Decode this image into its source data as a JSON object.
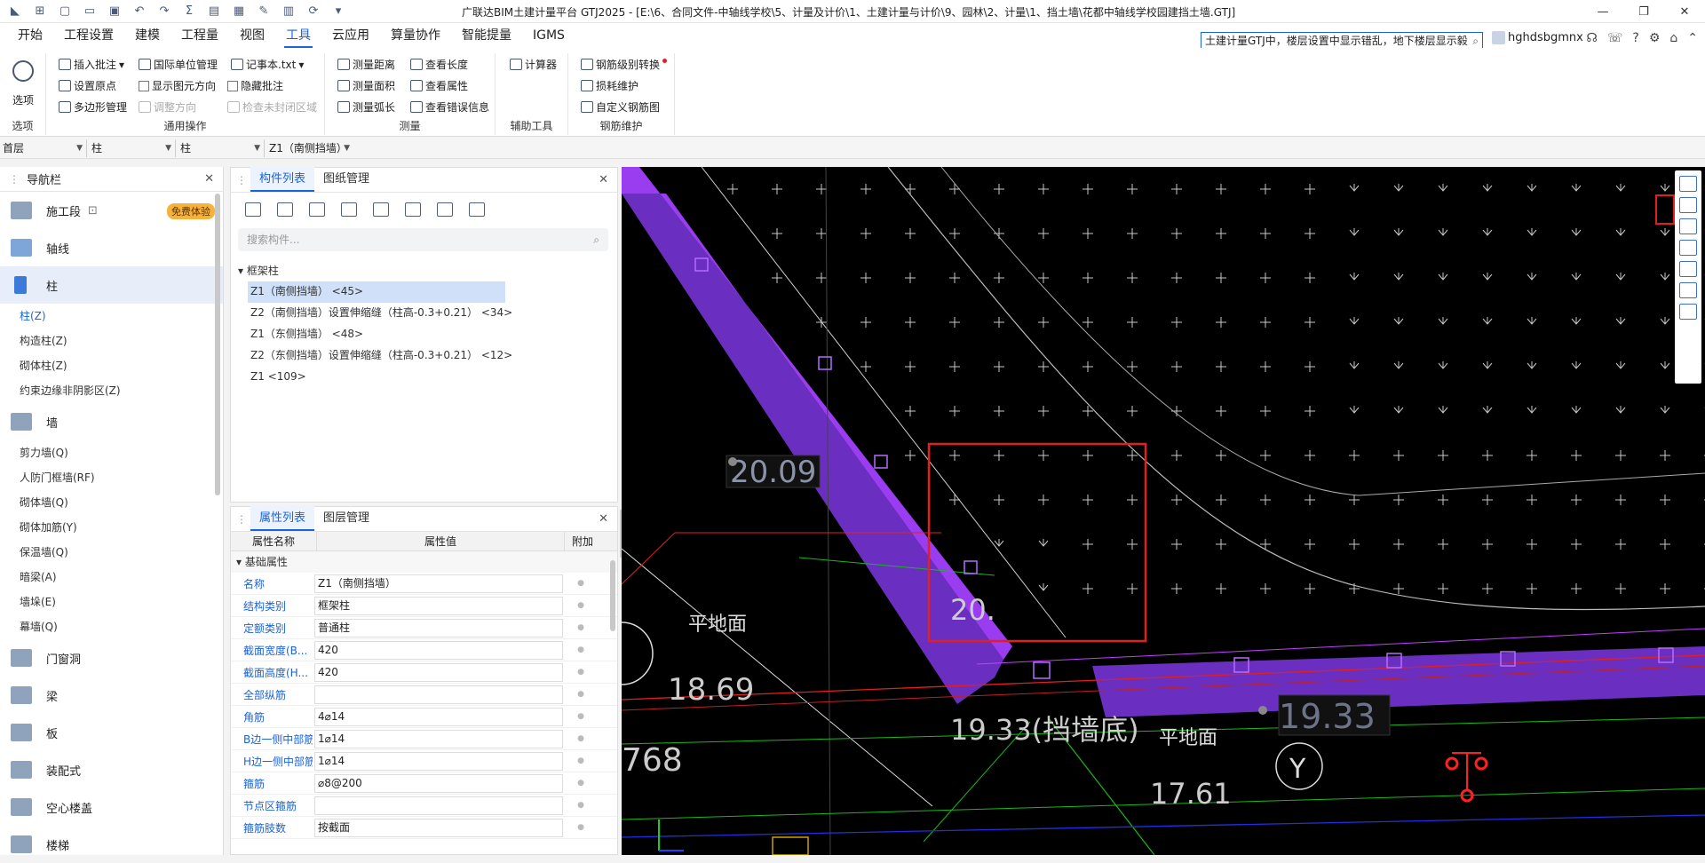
{
  "title": "广联达BIM土建计量平台 GTJ2025 - [E:\\6、合同文件-中轴线学校\\5、计量及计价\\1、土建计量与计价\\9、园林\\2、计量\\1、挡土墙\\花都中轴线学校园建挡土墙.GTJ]",
  "menus": [
    "开始",
    "工程设置",
    "建模",
    "工程量",
    "视图",
    "工具",
    "云应用",
    "算量协作",
    "智能提量",
    "IGMS"
  ],
  "search_value": "土建计量GTJ中，楼层设置中显示错乱，地下楼层显示毅",
  "username": "hghdsbgmnx",
  "ribbon": {
    "options": "选项",
    "options_group": "选项",
    "insert_comment": "插入批注",
    "intl_unit": "国际单位管理",
    "notepad": "记事本.txt",
    "set_origin": "设置原点",
    "show_dir": "显示图元方向",
    "hide_comment": "隐藏批注",
    "polygon_mgr": "多边形管理",
    "adjust_dir": "调整方向",
    "check_unclosed": "检查未封闭区域",
    "common_group": "通用操作",
    "measure_dist": "测量距离",
    "view_length": "查看长度",
    "measure_area": "测量面积",
    "view_attr": "查看属性",
    "measure_arc": "测量弧长",
    "view_errors": "查看错误信息",
    "measure_group": "测量",
    "calculator": "计算器",
    "aux_group": "辅助工具",
    "rebar_convert": "钢筋级别转换",
    "loss_maint": "损耗维护",
    "custom_rebar": "自定义钢筋图",
    "rebar_group": "钢筋维护"
  },
  "layer": {
    "floor": "首层",
    "type": "柱",
    "sub": "柱",
    "comp": "Z1（南侧挡墙）"
  },
  "nav": {
    "title": "导航栏",
    "free_badge": "免费体验",
    "cats": [
      {
        "label": "施工段"
      },
      {
        "label": "轴线"
      },
      {
        "label": "柱"
      },
      {
        "label": "墙"
      },
      {
        "label": "门窗洞"
      },
      {
        "label": "梁"
      },
      {
        "label": "板"
      },
      {
        "label": "装配式"
      },
      {
        "label": "空心楼盖"
      },
      {
        "label": "楼梯"
      }
    ],
    "col_items": [
      "柱(Z)",
      "构造柱(Z)",
      "砌体柱(Z)",
      "约束边缘非阴影区(Z)"
    ],
    "wall_items": [
      "剪力墙(Q)",
      "人防门框墙(RF)",
      "砌体墙(Q)",
      "砌体加筋(Y)",
      "保温墙(Q)",
      "暗梁(A)",
      "墙垛(E)",
      "幕墙(Q)"
    ]
  },
  "comp_panel": {
    "tab1": "构件列表",
    "tab2": "图纸管理",
    "search_placeholder": "搜索构件...",
    "group": "框架柱",
    "items": [
      "Z1（南侧挡墙）  <45>",
      "Z2（南侧挡墙）设置伸缩缝（柱高-0.3+0.21）  <34>",
      "Z1（东侧挡墙）  <48>",
      "Z2（东侧挡墙）设置伸缩缝（柱高-0.3+0.21）  <12>",
      "Z1 <109>"
    ]
  },
  "prop_panel": {
    "tab1": "属性列表",
    "tab2": "图层管理",
    "col_name": "属性名称",
    "col_value": "属性值",
    "col_extra": "附加",
    "group": "基础属性",
    "rows": [
      {
        "n": "名称",
        "v": "Z1（南侧挡墙）"
      },
      {
        "n": "结构类别",
        "v": "框架柱"
      },
      {
        "n": "定额类别",
        "v": "普通柱"
      },
      {
        "n": "截面宽度(B...",
        "v": "420"
      },
      {
        "n": "截面高度(H...",
        "v": "420"
      },
      {
        "n": "全部纵筋",
        "v": ""
      },
      {
        "n": "角筋",
        "v": "4⌀14"
      },
      {
        "n": "B边一侧中部筋",
        "v": "1⌀14"
      },
      {
        "n": "H边一侧中部筋",
        "v": "1⌀14"
      },
      {
        "n": "箍筋",
        "v": "⌀8@200"
      },
      {
        "n": "节点区箍筋",
        "v": ""
      },
      {
        "n": "箍筋肢数",
        "v": "按截面"
      }
    ]
  },
  "cad": {
    "t1": "20.09",
    "t2": "20.",
    "t3": "平地面",
    "t4": "18.69",
    "t5": "19.33(挡墙底)",
    "t6": "平地面",
    "t7": "19.33",
    "t8": "768",
    "t9": "17.61",
    "t10": "Y"
  },
  "colors": {
    "accent": "#1a63d8",
    "purple": "#7b2fd8",
    "red": "#e02020"
  }
}
